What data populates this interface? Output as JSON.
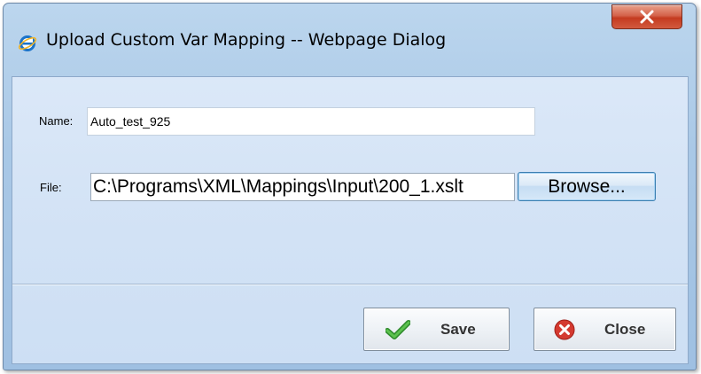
{
  "window": {
    "title": "Upload Custom Var Mapping -- Webpage Dialog"
  },
  "form": {
    "name_label": "Name:",
    "name_value": "Auto_test_925",
    "file_label": "File:",
    "file_value": "C:\\Programs\\XML\\Mappings\\Input\\200_1.xslt",
    "browse_label": "Browse..."
  },
  "actions": {
    "save_label": "Save",
    "close_label": "Close"
  },
  "icons": {
    "title_icon": "internet-explorer-icon",
    "window_close": "close-icon",
    "save": "checkmark-icon",
    "close": "close-circle-icon"
  },
  "colors": {
    "close_button": "#c43b20",
    "save_check": "#3ea83a",
    "close_circle": "#d43a30",
    "dialog_background": "#d2e2f5"
  }
}
